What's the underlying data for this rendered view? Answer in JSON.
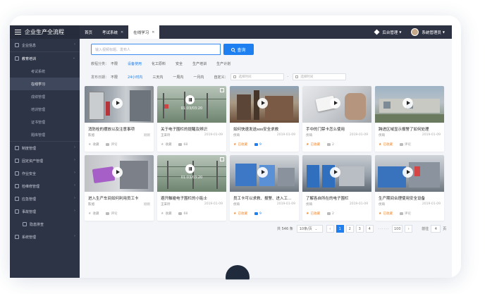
{
  "app": {
    "title": "企业生产全流程"
  },
  "sidebar": {
    "items": [
      {
        "label": "企业信息",
        "arrow": "›"
      },
      {
        "label": "教育培训",
        "arrow": "⌄",
        "open": true,
        "children": [
          {
            "label": "考试系统"
          },
          {
            "label": "在线学习",
            "active": true
          },
          {
            "label": "成绩管理"
          },
          {
            "label": "培训管理"
          },
          {
            "label": "证书管理"
          },
          {
            "label": "题库管理"
          }
        ]
      },
      {
        "label": "制度管理",
        "arrow": "›"
      },
      {
        "label": "固定资产管理",
        "arrow": "›"
      },
      {
        "label": "作业安全",
        "arrow": "›"
      },
      {
        "label": "检维修管理",
        "arrow": "›"
      },
      {
        "label": "应急管理",
        "arrow": "›"
      },
      {
        "label": "事故管理",
        "arrow": "›"
      },
      {
        "label": "隐患排查",
        "arrow": ""
      },
      {
        "label": "系统管理",
        "arrow": "›"
      }
    ]
  },
  "topbar": {
    "tabs": [
      {
        "label": "首页"
      },
      {
        "label": "考试系统"
      },
      {
        "label": "在线学习"
      }
    ],
    "backend_label": "后台管理",
    "user_label": "系统管理员"
  },
  "search": {
    "placeholder": "输入视频标题、发布人",
    "button": "查询"
  },
  "filters": {
    "category": {
      "label": "教程分类：",
      "options": [
        "不限",
        "设备使用",
        "化工原料",
        "安全",
        "生产培训",
        "生产计划"
      ],
      "selected": 1
    },
    "time": {
      "label": "发布日期：",
      "options": [
        "不限",
        "24小时内",
        "三天内",
        "一周内",
        "一月内",
        "自定义："
      ],
      "selected": 1
    },
    "date_from_placeholder": "选择时间",
    "date_to_placeholder": "选择时间",
    "dash": "-"
  },
  "videos": [
    {
      "title": "消防栓的摆放以及注意事项",
      "author": "陈旭",
      "date": "刚刚",
      "fav": "收藏",
      "comments": "评论",
      "fav_on": false,
      "com_on": false,
      "state": "play"
    },
    {
      "title": "关于电子围栏的提醒及辨识",
      "author": "王宋玲",
      "date": "2019-01-09",
      "fav": "收藏",
      "comments": "68",
      "fav_on": false,
      "com_on": false,
      "state": "pause",
      "time": "01:03/03:20"
    },
    {
      "title": "如何快速发送sos安全求救",
      "author": "伏琦",
      "date": "2019-01-09",
      "fav": "已收藏",
      "comments": "9",
      "fav_on": true,
      "com_on": true,
      "state": "play"
    },
    {
      "title": "手中的门禁卡怎么使用",
      "author": "伏琦",
      "date": "2019-01-09",
      "fav": "已收藏",
      "comments": "2",
      "fav_on": true,
      "com_on": false,
      "state": "play"
    },
    {
      "title": "跨进区域显示报警了如何处理",
      "author": "伏琦",
      "date": "2019-01-09",
      "fav": "已收藏",
      "comments": "评论",
      "fav_on": true,
      "com_on": false,
      "state": "play"
    },
    {
      "title": "进入生产车间如何利用员工卡",
      "author": "陈旭",
      "date": "刚刚",
      "fav": "收藏",
      "comments": "评论",
      "fav_on": false,
      "com_on": false,
      "state": "play"
    },
    {
      "title": "避开触碰电子围栏的小贴士",
      "author": "王宋玲",
      "date": "2019-01-09",
      "fav": "收藏",
      "comments": "68",
      "fav_on": false,
      "com_on": false,
      "state": "pause",
      "time": "01:03/03:20"
    },
    {
      "title": "员工卡可以求救、报警、进入工…",
      "author": "伏琦",
      "date": "2019-01-09",
      "fav": "已收藏",
      "comments": "9",
      "fav_on": true,
      "com_on": true,
      "state": "play"
    },
    {
      "title": "了解各自所在的电子围栏",
      "author": "伏琦",
      "date": "2019-01-09",
      "fav": "已收藏",
      "comments": "2",
      "fav_on": true,
      "com_on": false,
      "state": "play"
    },
    {
      "title": "生产期间合理使用安全设备",
      "author": "伏琦",
      "date": "2019-01-09",
      "fav": "已收藏",
      "comments": "评论",
      "fav_on": true,
      "com_on": false,
      "state": "play"
    }
  ],
  "pagination": {
    "total": "共 546 条",
    "page_size": "10条/页",
    "prev": "‹",
    "pages": [
      "1",
      "2",
      "3",
      "4"
    ],
    "current": "1",
    "dots": "······",
    "last": "100",
    "next": "›",
    "goto_label": "前往",
    "goto_value": "4",
    "goto_suffix": "页"
  },
  "colors": {
    "accent": "#1e7ff0",
    "sidebar": "#2d3446",
    "topbar": "#2e3344",
    "highlight": "#f5892a"
  }
}
